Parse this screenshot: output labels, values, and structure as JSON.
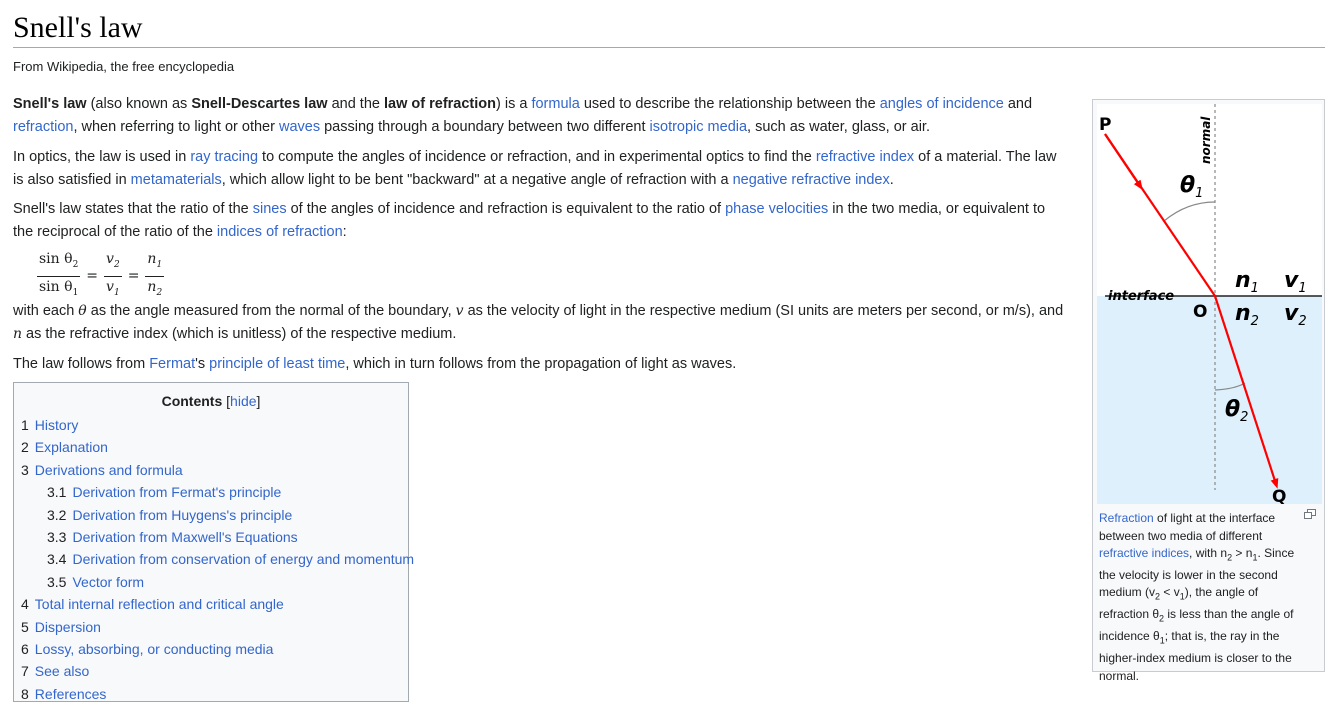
{
  "page": {
    "title": "Snell's law",
    "tagline": "From Wikipedia, the free encyclopedia"
  },
  "p1": {
    "s0": "Snell's law",
    "s1": " (also known as ",
    "s2": "Snell-Descartes law",
    "s3": " and the ",
    "s4": "law of refraction",
    "s5": ") is a ",
    "l1": "formula",
    "s6": " used to describe the relationship between the ",
    "l2": "angles of incidence",
    "s7": " and ",
    "l3": "refraction",
    "s8": ", when referring to light or other ",
    "l4": "waves",
    "s9": " passing through a boundary between two different ",
    "l5": "isotropic media",
    "s10": ", such as water, glass, or air."
  },
  "p2": {
    "s0": "In optics, the law is used in ",
    "l1": "ray tracing",
    "s1": " to compute the angles of incidence or refraction, and in experimental optics to find the ",
    "l2": "refractive index",
    "s2": " of a material. The law is also satisfied in ",
    "l3": "metamaterials",
    "s3": ", which allow light to be bent \"backward\" at a negative angle of refraction with a ",
    "l4": "negative refractive index",
    "s4": "."
  },
  "p3": {
    "s0": "Snell's law states that the ratio of the ",
    "l1": "sines",
    "s1": " of the angles of incidence and refraction is equivalent to the ratio of ",
    "l2": "phase velocities",
    "s2": " in the two media, or equivalent to the reciprocal of the ratio of the ",
    "l3": "indices of refraction",
    "s3": ":"
  },
  "formula": {
    "f1_num": "sin θ",
    "f1_num_sub": "2",
    "f1_den": "sin θ",
    "f1_den_sub": "1",
    "f2_num": "v",
    "f2_num_sub": "2",
    "f2_den": "v",
    "f2_den_sub": "1",
    "f3_num": "n",
    "f3_num_sub": "1",
    "f3_den": "n",
    "f3_den_sub": "2",
    "eq": "="
  },
  "p4": {
    "s0": "with each ",
    "m1": "θ",
    "s1": " as the angle measured from the normal of the boundary, ",
    "m2": "v",
    "s2": " as the velocity of light in the respective medium (SI units are meters per second, or m/s), and ",
    "m3": "n",
    "s3": " as the refractive index (which is unitless) of the respective medium."
  },
  "p5": {
    "s0": "The law follows from ",
    "l1": "Fermat",
    "s1": "'s ",
    "l2": "principle of least time",
    "s2": ", which in turn follows from the propagation of light as waves."
  },
  "toc": {
    "title": "Contents",
    "bracket_open": " [",
    "hide_label": "hide",
    "bracket_close": "]",
    "items": [
      {
        "num": "1",
        "label": "History"
      },
      {
        "num": "2",
        "label": "Explanation"
      },
      {
        "num": "3",
        "label": "Derivations and formula"
      },
      {
        "num": "3.1",
        "label": "Derivation from Fermat's principle"
      },
      {
        "num": "3.2",
        "label": "Derivation from Huygens's principle"
      },
      {
        "num": "3.3",
        "label": "Derivation from Maxwell's Equations"
      },
      {
        "num": "3.4",
        "label": "Derivation from conservation of energy and momentum"
      },
      {
        "num": "3.5",
        "label": "Vector form"
      },
      {
        "num": "4",
        "label": "Total internal reflection and critical angle"
      },
      {
        "num": "5",
        "label": "Dispersion"
      },
      {
        "num": "6",
        "label": "Lossy, absorbing, or conducting media"
      },
      {
        "num": "7",
        "label": "See also"
      },
      {
        "num": "8",
        "label": "References"
      }
    ]
  },
  "figure": {
    "label_P": "P",
    "label_Q": "Q",
    "label_O": "O",
    "label_normal": "normal",
    "label_interface": "interface",
    "theta1": "θ",
    "theta1_sub": "1",
    "theta2": "θ",
    "theta2_sub": "2",
    "n1": "n",
    "n1_sub": "1",
    "n2": "n",
    "n2_sub": "2",
    "v1": "v",
    "v1_sub": "1",
    "v2": "v",
    "v2_sub": "2",
    "colors": {
      "ray": "#ff0000",
      "lower_medium": "#ddf0fb",
      "upper_medium": "#ffffff"
    },
    "enlarge_icon": "enlarge-icon",
    "caption": {
      "l1": "Refraction",
      "s1": " of light at the interface between two media of different ",
      "l2": "refractive indices",
      "s2": ", with n",
      "s2_sub": "2",
      "s3": " > n",
      "s3_sub": "1",
      "s4": ". Since the velocity is lower in the second medium (v",
      "s4_sub": "2",
      "s5": " < v",
      "s5_sub": "1",
      "s6": "), the angle of refraction θ",
      "s6_sub": "2",
      "s7": " is less than the angle of incidence θ",
      "s7_sub": "1",
      "s8": "; that is, the ray in the higher-index medium is closer to the normal."
    }
  }
}
